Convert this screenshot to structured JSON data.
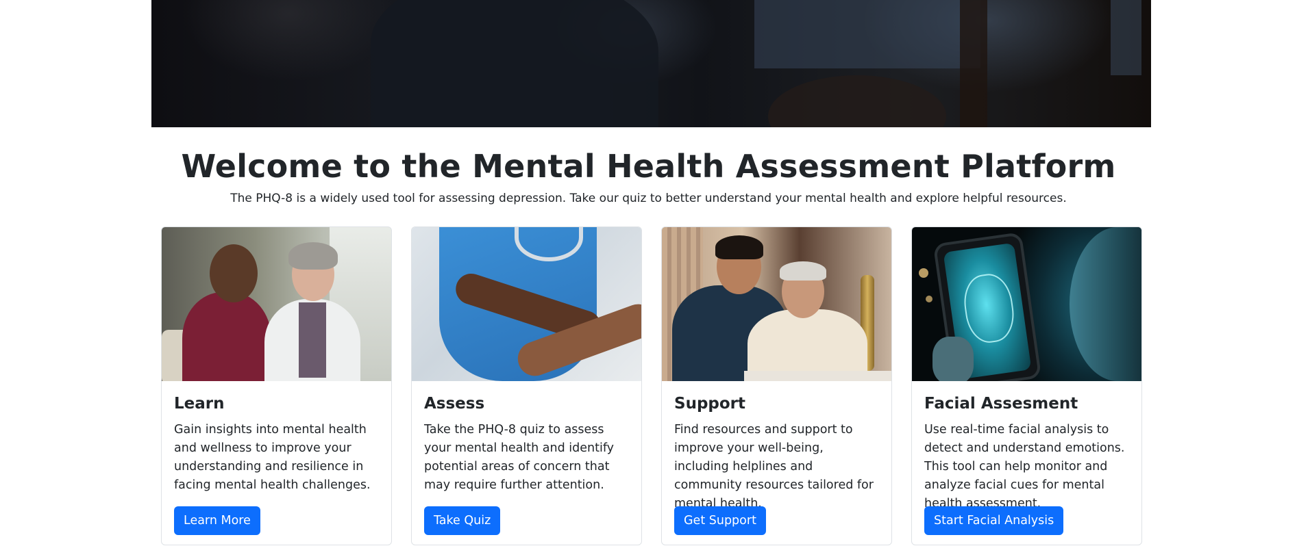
{
  "welcome": {
    "title": "Welcome to the Mental Health Assessment Platform",
    "subtitle": "The PHQ-8 is a widely used tool for assessing depression. Take our quiz to better understand your mental health and explore helpful resources."
  },
  "cards": [
    {
      "title": "Learn",
      "text": "Gain insights into mental health and wellness to improve your understanding and resilience in facing mental health challenges.",
      "button": "Learn More"
    },
    {
      "title": "Assess",
      "text": "Take the PHQ-8 quiz to assess your mental health and identify potential areas of concern that may require further attention.",
      "button": "Take Quiz"
    },
    {
      "title": "Support",
      "text": "Find resources and support to improve your well-being, including helplines and community resources tailored for mental health.",
      "button": "Get Support"
    },
    {
      "title": "Facial Assesment",
      "text": "Use real-time facial analysis to detect and understand emotions. This tool can help monitor and analyze facial cues for mental health assessment.",
      "button": "Start Facial Analysis"
    }
  ],
  "colors": {
    "primary_button": "#0d6efd",
    "text": "#212529",
    "card_border": "#dee2e6"
  }
}
